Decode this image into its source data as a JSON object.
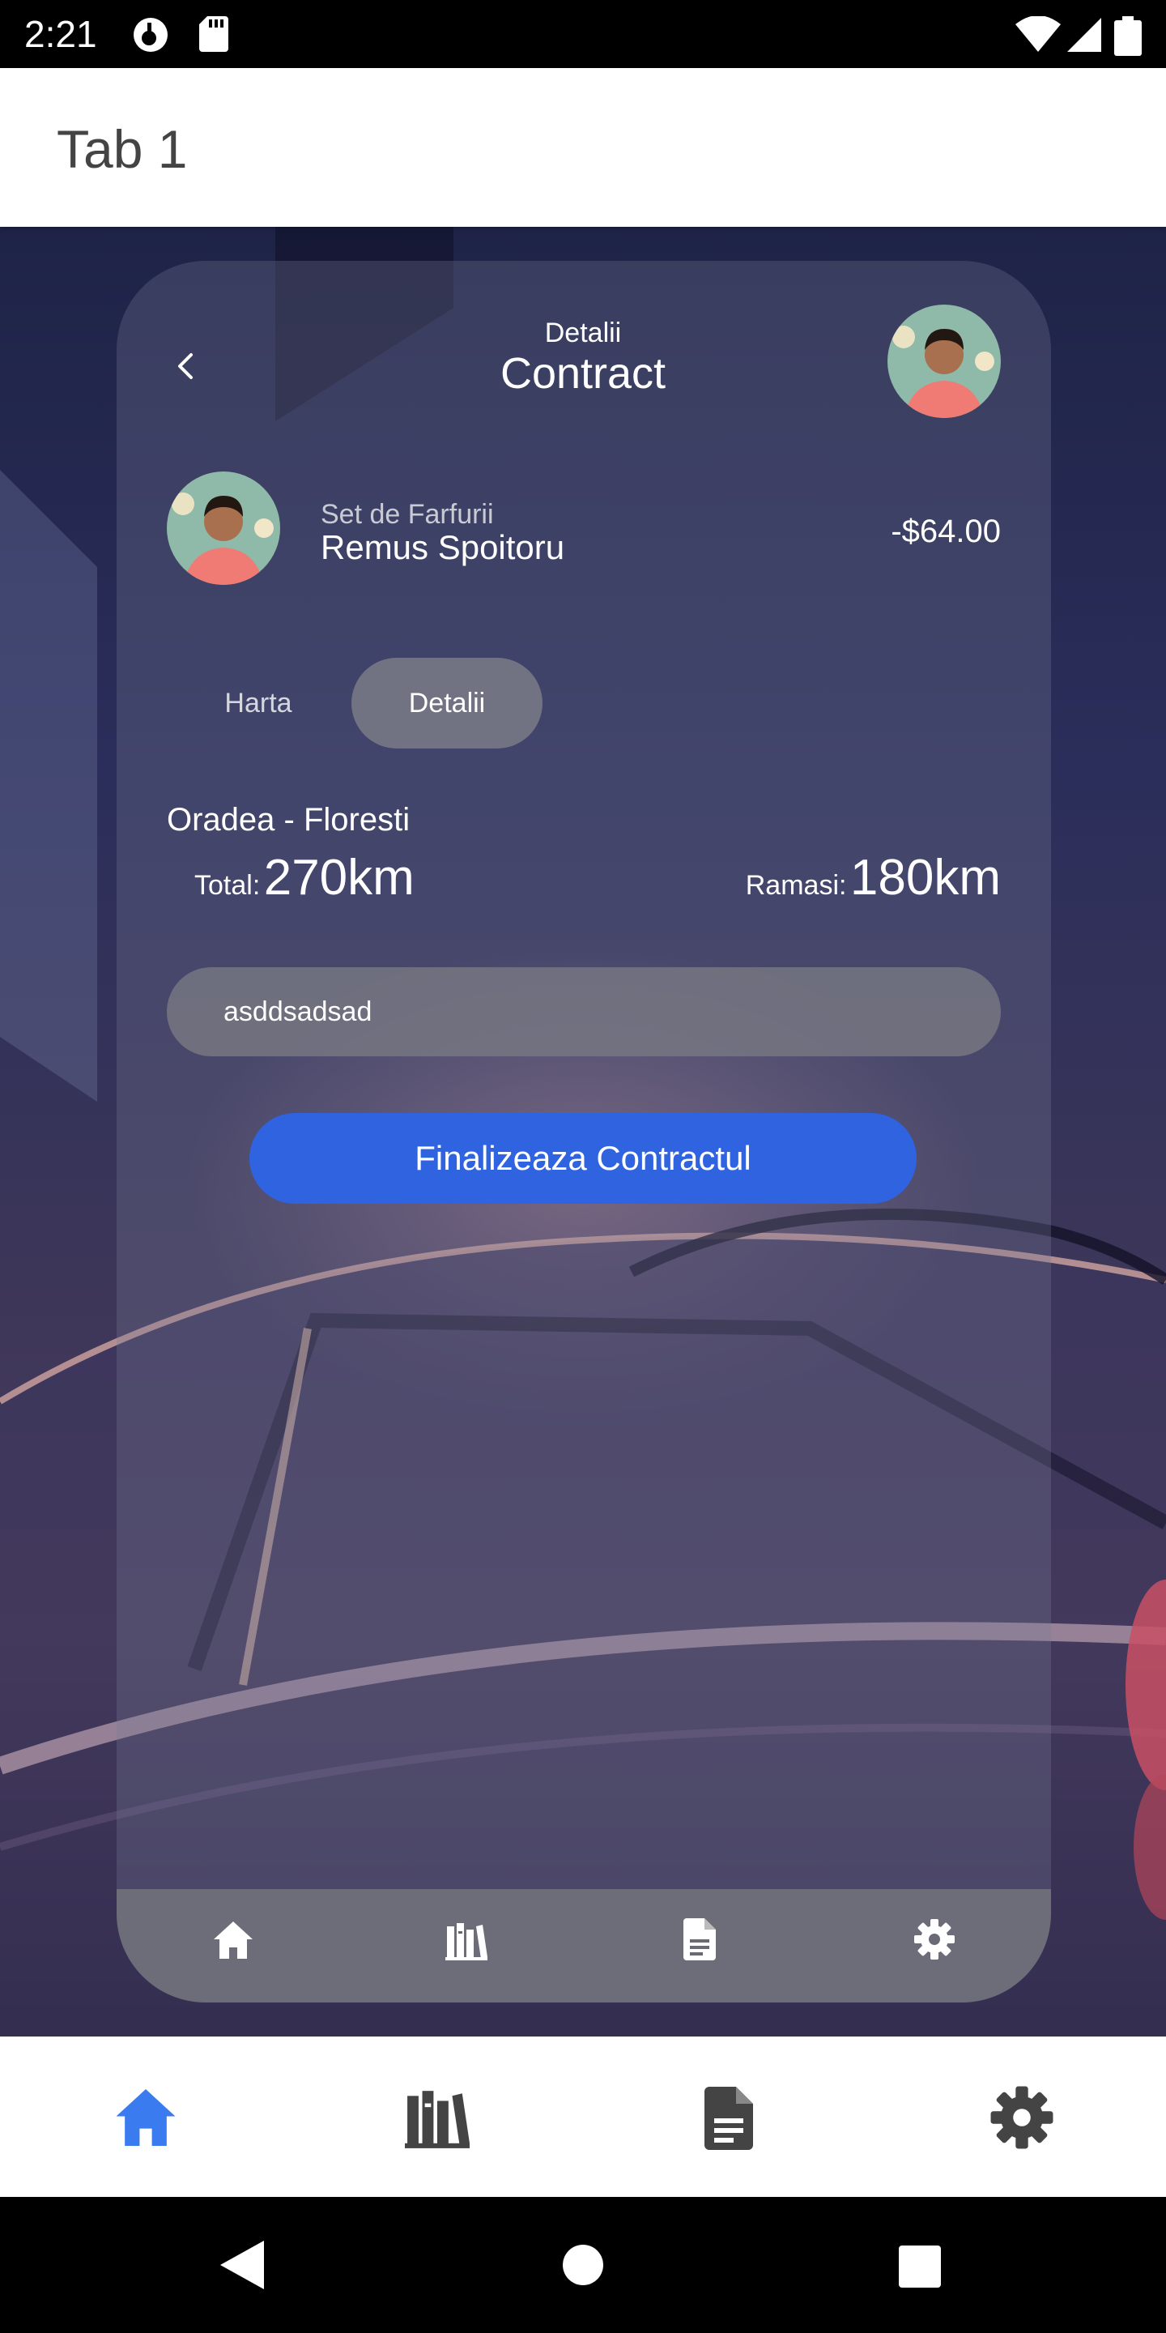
{
  "status_bar": {
    "time": "2:21"
  },
  "app_bar": {
    "title": "Tab 1"
  },
  "header": {
    "subtitle": "Detalii",
    "title": "Contract"
  },
  "transaction": {
    "item": "Set de Farfurii",
    "name": "Remus Spoitoru",
    "amount": "-$64.00"
  },
  "tabs": [
    {
      "label": "Harta",
      "selected": false
    },
    {
      "label": "Detalii",
      "selected": true
    }
  ],
  "route": {
    "name": "Oradea - Floresti",
    "total_label": "Total:",
    "total_value": "270km",
    "remaining_label": "Ramasi:",
    "remaining_value": "180km"
  },
  "note": {
    "value": "asddsadsad"
  },
  "finish_button": {
    "label": "Finalizeaza Contractul"
  },
  "inner_nav": {
    "items": [
      "home-icon",
      "library-icon",
      "document-icon",
      "settings-icon"
    ]
  },
  "bottom_nav": {
    "items": [
      "home-icon",
      "library-icon",
      "document-icon",
      "settings-icon"
    ],
    "active": "home-icon"
  },
  "colors": {
    "accent": "#2f63e0",
    "active_nav": "#3a7bf0",
    "inactive_nav": "#444444"
  }
}
